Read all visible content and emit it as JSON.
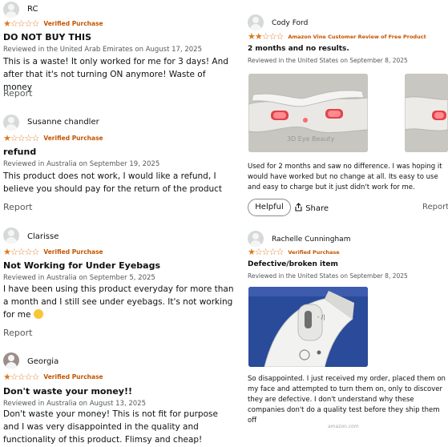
{
  "left_reviews": [
    {
      "reviewer": "RC",
      "rating": "1 of 5 stars",
      "stars_glyph": "★☆☆☆☆",
      "badge": "Verified Purchase",
      "title": "DO NOT BUY THIS",
      "meta": "Reviewed in the United Arab Emirates on August 17, 2025",
      "body": "This is a waste! It only worked for me for 3 days! And after that it's not turning ON anymore! Waste of money",
      "report": "Report"
    },
    {
      "reviewer": "Susanne chandler",
      "rating": "1 of 5 stars",
      "stars_glyph": "★☆☆☆☆",
      "badge": "Verified Purchase",
      "title": "refund",
      "meta": "Reviewed in Australia on September 19, 2025",
      "body": "This product does not work, I would like a refund, I believe you should pay for the return of the product",
      "report": "Report"
    },
    {
      "reviewer": "Clarisse",
      "rating": "1 of 5 stars",
      "stars_glyph": "★☆☆☆☆",
      "badge": "Verified Purchase",
      "title": "Not Working for Under Eyebags",
      "meta": "Reviewed in Australia on September 5, 2025",
      "body": "I have been using this product everyday for more than a month and I still see under eyebags. It's not working for me",
      "report": "Report"
    },
    {
      "reviewer": "Georgia",
      "rating": "1 of 5 stars",
      "stars_glyph": "★☆☆☆☆",
      "badge": "Verified Purchase",
      "title": "Don't waste your money!!",
      "meta": "Reviewed in Australia on August 13, 2025",
      "body": "Don't waste your money! This is not fit for purpose and I was very disappointed in the quality and functionality of this product. Flimsy and cheap!"
    }
  ],
  "right_reviews": [
    {
      "reviewer": "Cody Ford",
      "rating": "2 of 5 stars",
      "stars_glyph": "★★☆☆☆",
      "badge": "Amazon Vine Customer Review of Free Product",
      "title": "2 months and no results.",
      "meta": "Reviewed in the United States on September 8, 2025",
      "photo_caption": "3D Eye Beauty",
      "body": "Used for 2 months and saw no difference. I was hoping it would have worked but no change at all. Its easy to use and easy to charge but it just didn't work for me.",
      "helpful": "Helpful",
      "share": "Share",
      "report": "Report"
    },
    {
      "reviewer": "Rachelle Cunningham",
      "rating": "1 of 5 stars",
      "stars_glyph": "★☆☆☆☆",
      "badge": "Verified Purchase",
      "title": "Defective/broken item",
      "meta": "Reviewed in the United States on September 8, 2025",
      "photo_marks": "- /|",
      "body": "So disappointed. I just received my order, placed them on my face and attempted to turn them on, only to discover they are defective. I don't understand why these companies don't do a quality test before they ship them off",
      "watermark": "amazon.com"
    }
  ],
  "icons": {
    "avatar": "person-silhouette-icon",
    "share": "share-icon",
    "emoji": "disappointed-face-icon"
  },
  "colors": {
    "stars": "#de7921",
    "badge": "#c45500",
    "meta": "#565959",
    "text": "#0f1111"
  }
}
